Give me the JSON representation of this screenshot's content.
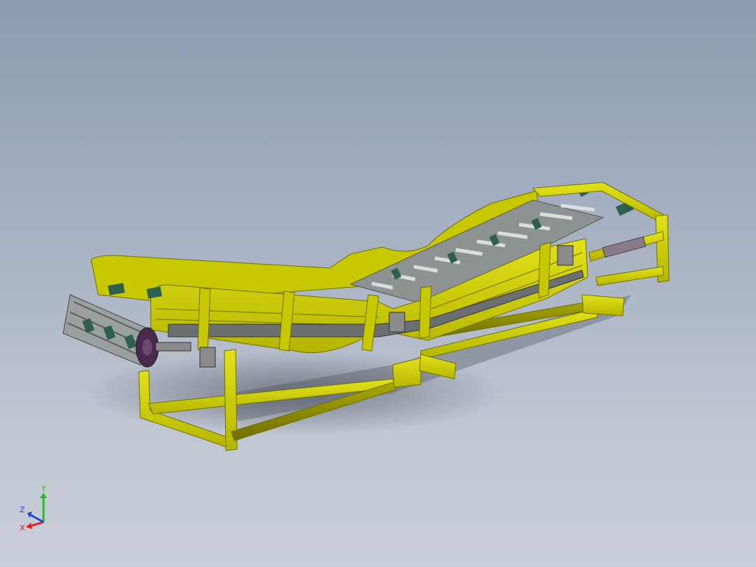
{
  "viewport": {
    "background_top": "#8d9bb0",
    "background_bottom": "#c9ced8"
  },
  "model": {
    "frame_color": "#d4d400",
    "frame_shadow": "#9a9a00",
    "roller_color": "#2f5f4f",
    "belt_color": "#9aa0a0",
    "hub_color": "#4a2a4a"
  },
  "triad": {
    "x_label": "X",
    "y_label": "Y",
    "z_label": "Z",
    "x_color": "#e02020",
    "y_color": "#20c020",
    "z_color": "#2040e0"
  }
}
